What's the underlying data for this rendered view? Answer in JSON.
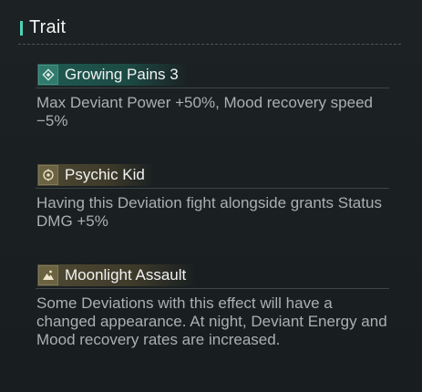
{
  "section": {
    "title": "Trait"
  },
  "traits": [
    {
      "name": "Growing Pains 3",
      "icon": "diamond-icon",
      "accent": "#2f7a6d",
      "description": "Max Deviant Power +50%, Mood recovery speed −5%"
    },
    {
      "name": "Psychic Kid",
      "icon": "crosshair-icon",
      "accent": "#6a6240",
      "description": "Having this Deviation fight alongside grants Status DMG +5%"
    },
    {
      "name": "Moonlight Assault",
      "icon": "mountain-icon",
      "accent": "#6a6240",
      "description": "Some Deviations with this effect will have a changed appearance. At night, Deviant Energy and Mood recovery rates are increased."
    }
  ]
}
